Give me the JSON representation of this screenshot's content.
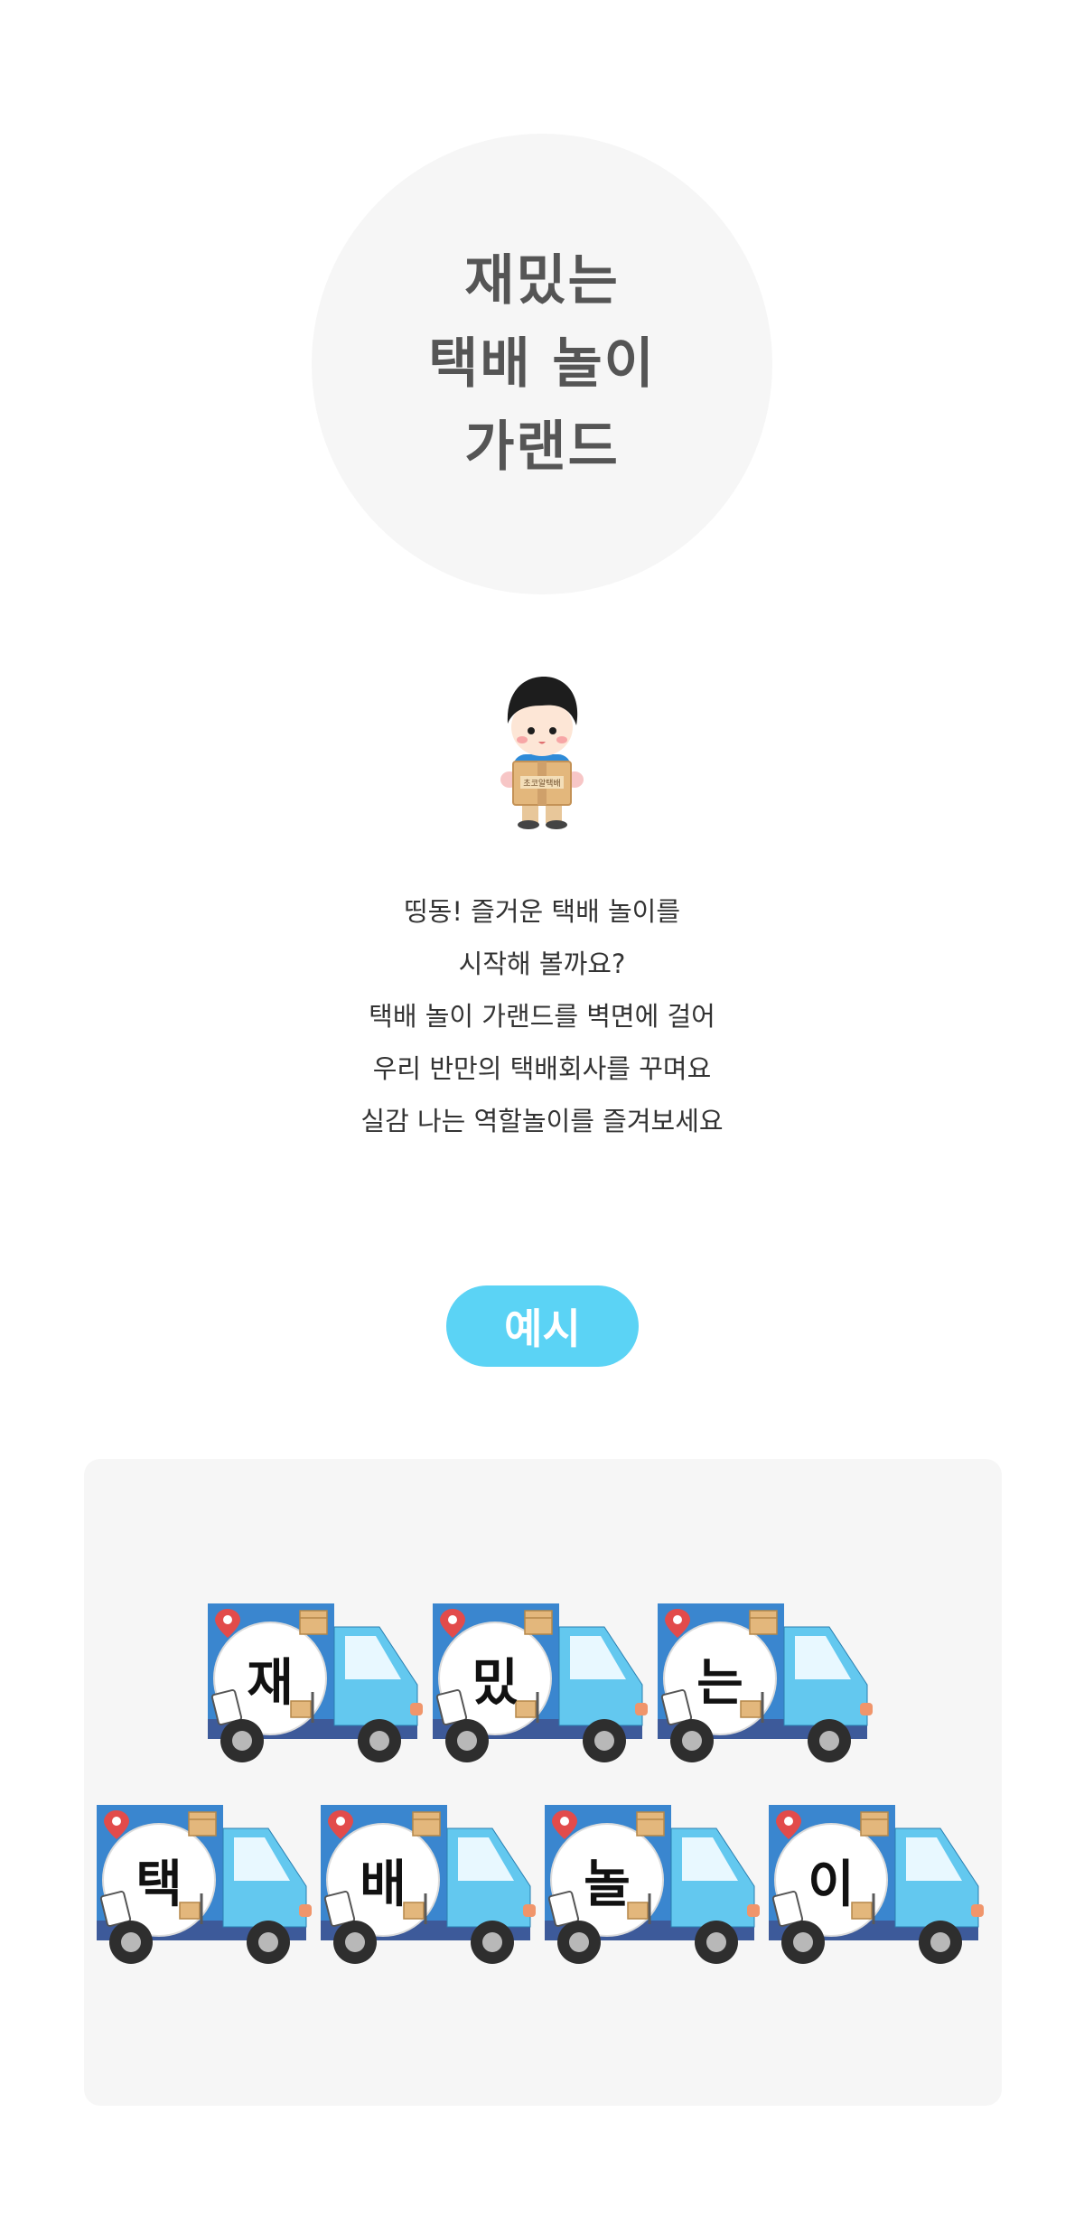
{
  "title": {
    "lines": [
      "재밌는",
      "택배 놀이",
      "가랜드"
    ]
  },
  "character": {
    "box_text": "초코알택배",
    "icon": "delivery-character-illustration"
  },
  "description": {
    "lines": [
      "띵동! 즐거운 택배 놀이를",
      "시작해 볼까요?",
      "택배 놀이 가랜드를 벽면에 걸어",
      "우리 반만의 택배회사를 꾸며요",
      "실감 나는 역할놀이를 즐겨보세요"
    ]
  },
  "example": {
    "label": "예시",
    "row1": [
      "재",
      "밌",
      "는"
    ],
    "row2": [
      "택",
      "배",
      "놀",
      "이"
    ]
  },
  "colors": {
    "title_circle": "#f6f6f6",
    "pill": "#5bd3f5",
    "truck_body": "#63c8ef",
    "truck_cargo": "#3a86cf"
  }
}
